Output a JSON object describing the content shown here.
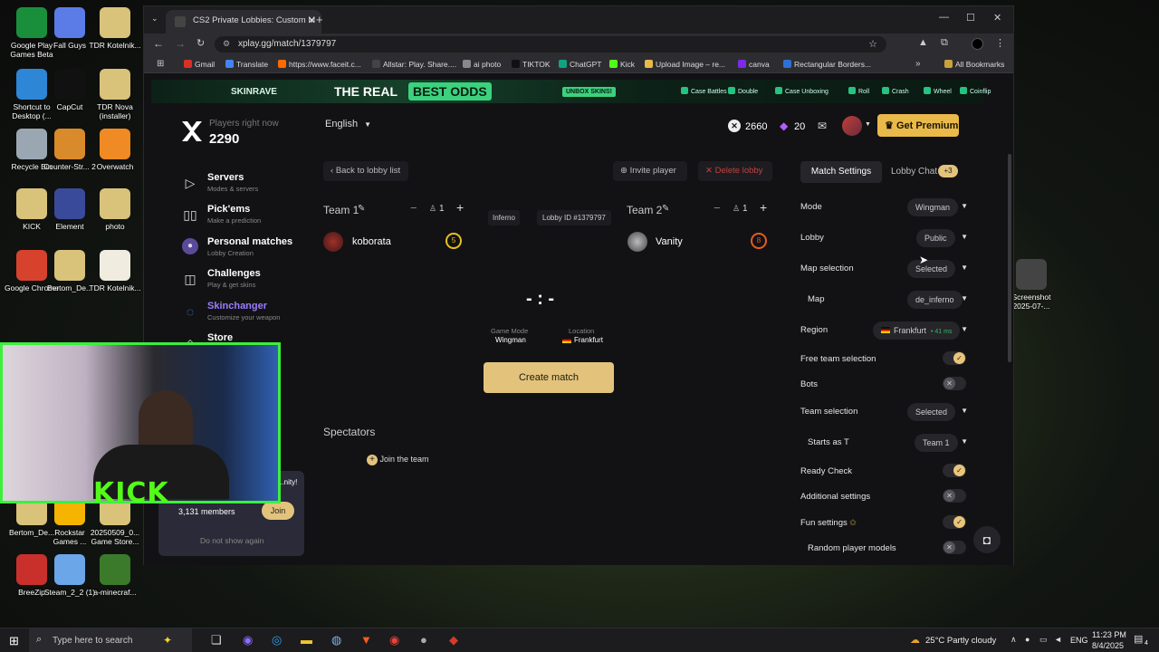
{
  "desktop_icons": [
    {
      "label": "Google Play Games Beta",
      "color": "#1a8f3b"
    },
    {
      "label": "Fall Guys",
      "color": "#5b7be6"
    },
    {
      "label": "TDR Kotelnik...",
      "color": "#d9c27a"
    },
    {
      "label": "Shortcut to Desktop (...",
      "color": "#2d86d6"
    },
    {
      "label": "CapCut",
      "color": "#111111"
    },
    {
      "label": "TDR Nova (installer)",
      "color": "#d9c27a"
    },
    {
      "label": "Recycle Bin",
      "color": "#9aa7b3"
    },
    {
      "label": "Counter-Str... 2",
      "color": "#d98a2b"
    },
    {
      "label": "Overwatch",
      "color": "#f08a24"
    },
    {
      "label": "KICK",
      "color": "#d9c27a"
    },
    {
      "label": "Element",
      "color": "#3a4a9b"
    },
    {
      "label": "photo",
      "color": "#d9c27a"
    },
    {
      "label": "Google Chrome",
      "color": "#d7422d"
    },
    {
      "label": "Bertom_De...",
      "color": "#d9c27a"
    },
    {
      "label": "TDR Kotelnik...",
      "color": "#f0ece0"
    },
    {
      "label": "Bertom_De...",
      "color": "#d9c27a"
    },
    {
      "label": "Rockstar Games ...",
      "color": "#f4b400"
    },
    {
      "label": "20250509_0... Game Store...",
      "color": "#d9c27a"
    },
    {
      "label": "BreeZip",
      "color": "#c9302c"
    },
    {
      "label": "Steam_2_2 (1)",
      "color": "#6aa6e8"
    },
    {
      "label": "a-minecraf...",
      "color": "#3b7a2a"
    },
    {
      "label": "Screenshot 2025-07-...",
      "color": "#444444"
    }
  ],
  "browser": {
    "tab_title": "CS2 Private Lobbies: Custom M",
    "url": "xplay.gg/match/1379797",
    "bookmarks": [
      "Gmail",
      "Translate",
      "https://www.faceit.c...",
      "Allstar: Play. Share....",
      "ai photo",
      "TIKTOK",
      "ChatGPT",
      "Kick",
      "Upload Image – re...",
      "canva",
      "Rectangular Borders..."
    ],
    "all_bookmarks": "All Bookmarks"
  },
  "banner": {
    "brand": "SKINRAVE",
    "slogan_1": "THE REAL",
    "slogan_2": "BEST ODDS",
    "cta": "UNBOX SKINS!",
    "items": [
      "Case Battles",
      "Double",
      "Case Unboxing",
      "Roll",
      "Crash",
      "Wheel",
      "Coinflip"
    ]
  },
  "header": {
    "players_label": "Players right now",
    "players_count": "2290",
    "language": "English",
    "coins": "2660",
    "gems": "20",
    "premium": "Get Premium"
  },
  "sidebar": [
    {
      "title": "Servers",
      "subtitle": "Modes & servers",
      "icon": "▷"
    },
    {
      "title": "Pick'ems",
      "subtitle": "Make a prediction",
      "icon": "▯▯"
    },
    {
      "title": "Personal matches",
      "subtitle": "Lobby Creation",
      "icon": "●"
    },
    {
      "title": "Challenges",
      "subtitle": "Play & get skins",
      "icon": "◫"
    },
    {
      "title": "Skinchanger",
      "subtitle": "Customize your weapon",
      "icon": "◌"
    },
    {
      "title": "Store",
      "subtitle": "",
      "icon": "◇"
    }
  ],
  "promo": {
    "text": "...nity!",
    "members": "3,131 members",
    "join": "Join",
    "dismiss": "Do not show again"
  },
  "lobby": {
    "back": "Back to lobby list",
    "invite": "Invite player",
    "delete": "Delete lobby",
    "team1": "Team 1",
    "team2": "Team 2",
    "team1_count": "1",
    "team2_count": "1",
    "map_tag": "Inferno",
    "lobby_id": "Lobby ID #1379797",
    "player1": "koborata",
    "player1_level": "5",
    "player2": "Vanity",
    "player2_level": "8",
    "score": "- : -",
    "game_mode_label": "Game Mode",
    "game_mode": "Wingman",
    "location_label": "Location",
    "location": "Frankfurt",
    "create": "Create match",
    "spectators": "Spectators",
    "join_team": "Join the team"
  },
  "settings": {
    "tab_active": "Match Settings",
    "tab_chat": "Lobby Chat",
    "chat_badge": "+3",
    "rows": [
      {
        "label": "Mode",
        "value": "Wingman"
      },
      {
        "label": "Lobby",
        "value": "Public"
      },
      {
        "label": "Map selection",
        "value": "Selected"
      },
      {
        "label": "Map",
        "value": "de_inferno"
      },
      {
        "label": "Region",
        "value": "Frankfurt",
        "extra": "• 41 ms"
      },
      {
        "label": "Free team selection",
        "toggle": true
      },
      {
        "label": "Bots",
        "toggle": false
      },
      {
        "label": "Team selection",
        "value": "Selected"
      },
      {
        "label": "Starts as T",
        "value": "Team 1"
      },
      {
        "label": "Ready Check",
        "toggle": true
      },
      {
        "label": "Additional settings",
        "toggle": false
      },
      {
        "label": "Fun settings",
        "toggle": true
      },
      {
        "label": "Random player models",
        "toggle": false
      }
    ]
  },
  "stream_overlay": {
    "logo": "KICK"
  },
  "taskbar": {
    "search_placeholder": "Type here to search",
    "weather": "25°C  Partly cloudy",
    "lang": "ENG",
    "time": "11:23 PM",
    "date": "8/4/2025",
    "notif": "4"
  }
}
